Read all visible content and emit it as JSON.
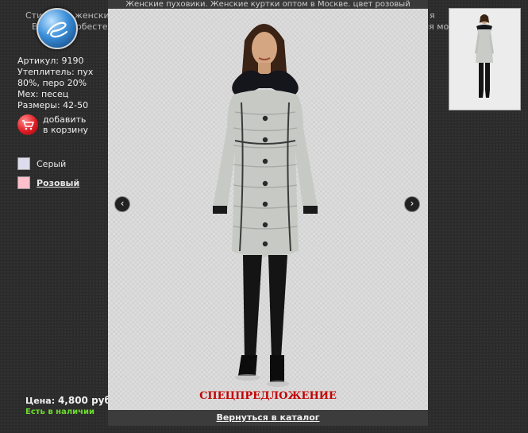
{
  "background_text": {
    "line1_left": "Сти",
    "line1_mid": "женски",
    "line1_right": "я",
    "line2_left": "В",
    "line2_mid": "обесте",
    "line2_right": "ия мо"
  },
  "modal": {
    "title": "Женские пуховики. Женские куртки оптом в Москве. цвет розовый",
    "special_label": "СПЕЦПРЕДЛОЖЕНИЕ",
    "back_link": "Вернуться в каталог",
    "prev_icon": "‹",
    "next_icon": "›"
  },
  "product": {
    "article": "Артикул: 9190",
    "filling_line1": "Утеплитель: пух",
    "filling_line2": "80%, перо 20%",
    "fur": "Мех: песец",
    "sizes": "Размеры: 42-50",
    "cart_line1": "добавить",
    "cart_line2": "в корзину",
    "price_label": "Цена:",
    "price_value": "4,800 руб.",
    "stock": "Есть в наличии"
  },
  "colors": [
    {
      "label": "Серый",
      "swatch": "#dcdcec",
      "selected": false
    },
    {
      "label": "Розовый",
      "swatch": "#ffc0cb",
      "selected": true
    }
  ],
  "theme": {
    "accent_red": "#c40000",
    "stock_green": "#6ddc2b"
  }
}
